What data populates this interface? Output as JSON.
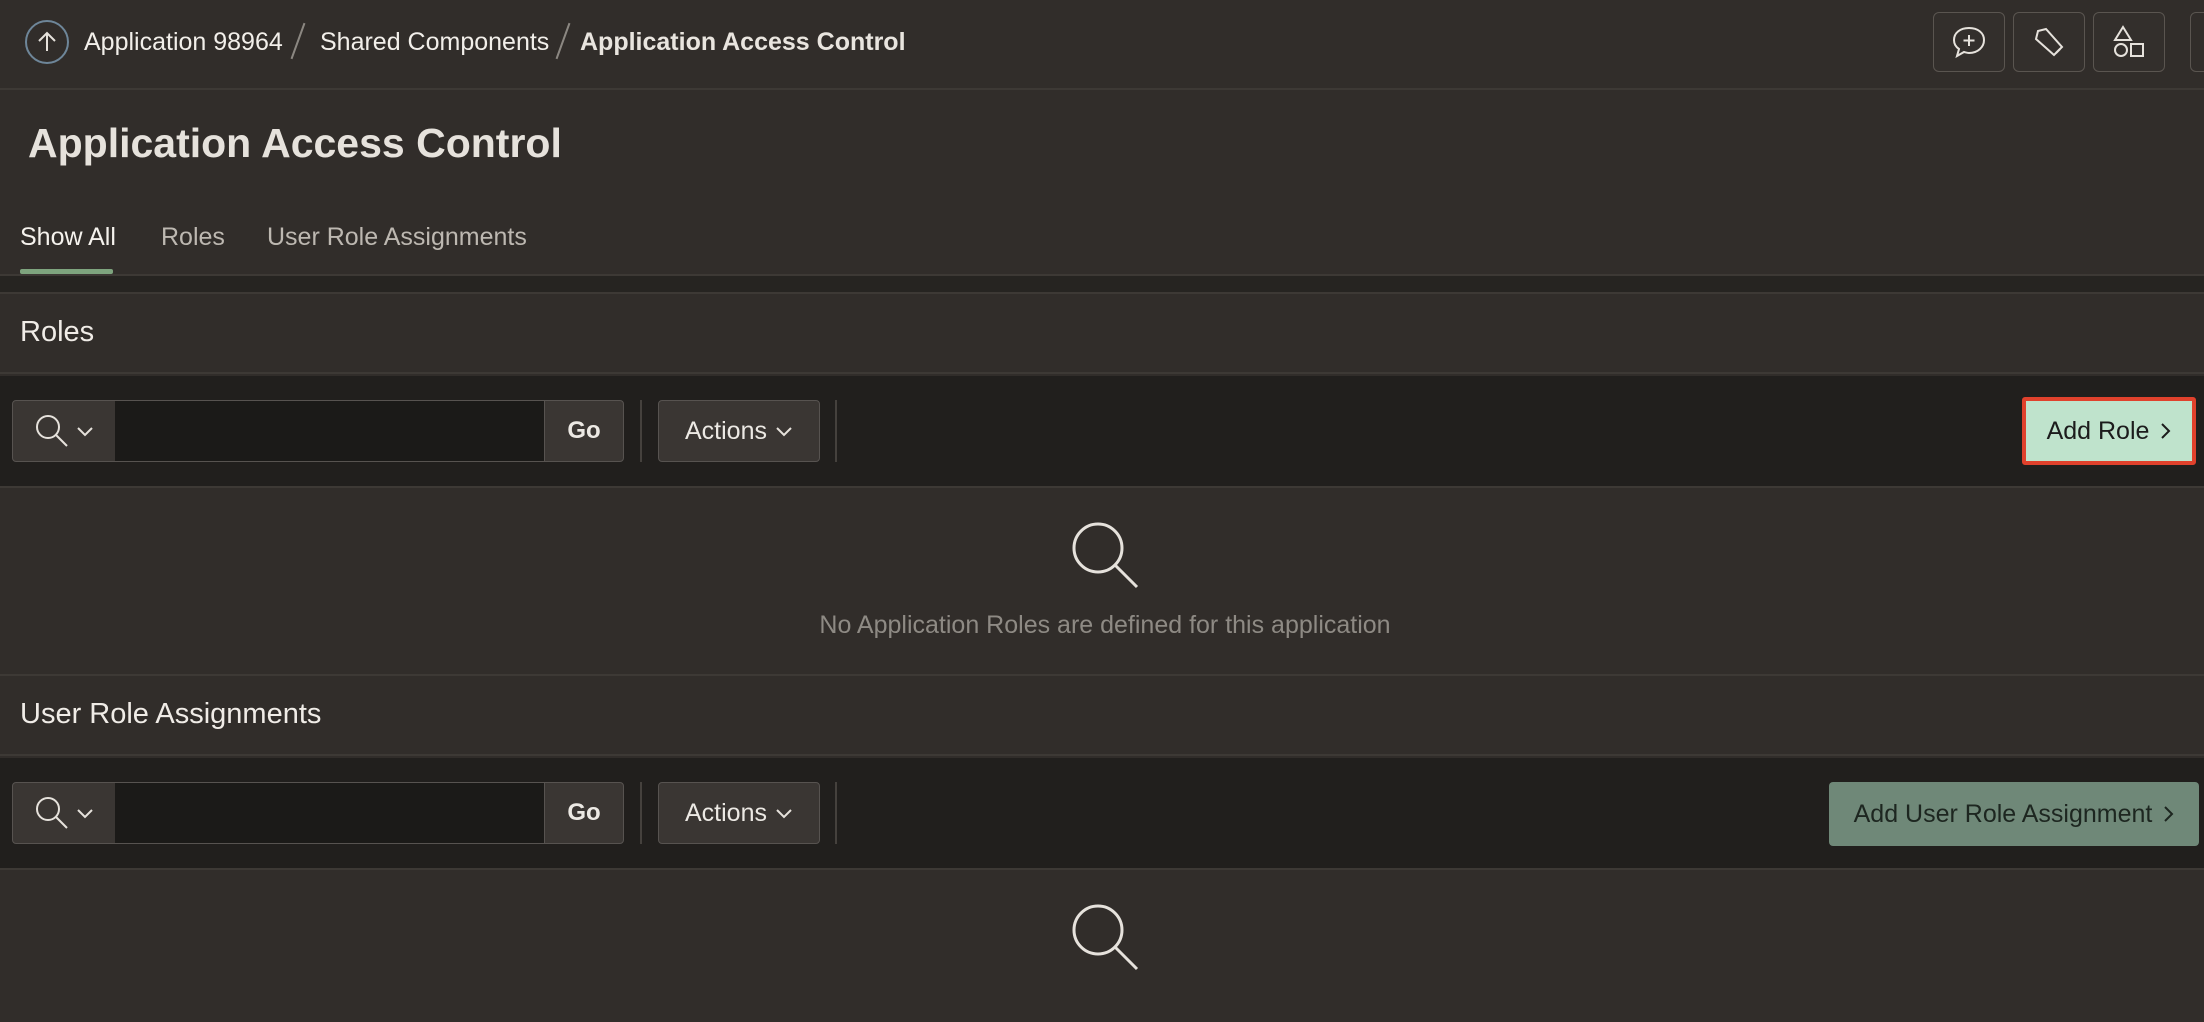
{
  "breadcrumb": {
    "items": [
      "Application 98964",
      "Shared Components",
      "Application Access Control"
    ]
  },
  "page": {
    "title": "Application Access Control"
  },
  "tabs": [
    {
      "label": "Show All",
      "active": true
    },
    {
      "label": "Roles",
      "active": false
    },
    {
      "label": "User Role Assignments",
      "active": false
    }
  ],
  "toolbar_icons": [
    "feedback-icon",
    "pencil-icon",
    "shapes-icon"
  ],
  "roles": {
    "title": "Roles",
    "search_value": "",
    "go_label": "Go",
    "actions_label": "Actions",
    "add_button_label": "Add Role",
    "empty_message": "No Application Roles are defined for this application"
  },
  "user_roles": {
    "title": "User Role Assignments",
    "search_value": "",
    "go_label": "Go",
    "actions_label": "Actions",
    "add_button_label": "Add User Role Assignment"
  },
  "colors": {
    "background": "#312d2a",
    "toolbar_band": "#211f1d",
    "tab_accent": "#7ea47e",
    "add_role_bg": "#bfe3cc",
    "highlight_border": "#e0412c",
    "add_ura_bg": "#6f8878"
  }
}
